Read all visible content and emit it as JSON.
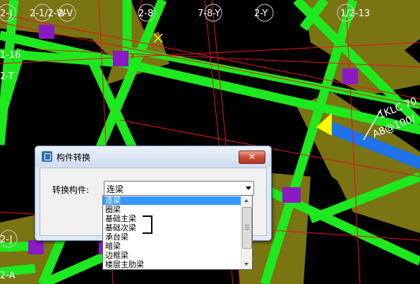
{
  "cad": {
    "axis_labels": [
      "2-J",
      "2-1/2-W",
      "2-V",
      "2-8",
      "7-8-Y",
      "2-Y",
      "1/2-13",
      "1-16",
      "2-T",
      "2-J",
      "2-A"
    ],
    "beam_annotation": [
      "1KLC 70",
      "A8@100/"
    ],
    "colors": {
      "background": "#000000",
      "slab": "#7a7413",
      "beam": "#1ee81e",
      "column": "#8a1ac4",
      "gridline": "#e8131b",
      "selected_beam": "#1e73e8",
      "marker": "#ffff00"
    }
  },
  "dialog": {
    "title": "构件转换",
    "close_label": "✕",
    "field_label": "转换构件:",
    "selected_value": "连梁",
    "options": [
      "连梁",
      "圈梁",
      "基础主梁",
      "基础次梁",
      "承台梁",
      "暗梁",
      "边框梁",
      "楼层主肋梁"
    ],
    "selected_index": 0
  },
  "icons": {
    "title_icon": "app-icon",
    "close": "close-icon",
    "dropdown_arrow": "chevron-down-icon",
    "scroll_up": "scroll-up-icon",
    "scroll_down": "scroll-down-icon"
  }
}
